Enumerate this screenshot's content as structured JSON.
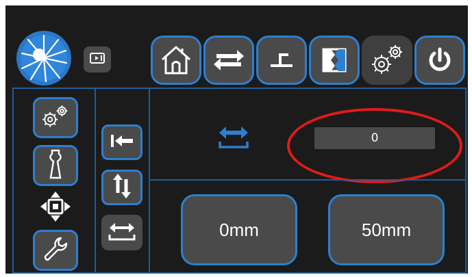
{
  "theme": {
    "background": "#1b1b1b",
    "button_fill": "#4a4a4a",
    "accent_border": "#2d7fd0",
    "panel_border": "#1f5d9a",
    "highlight": "#e11b1b",
    "text": "#ffffff"
  },
  "header": {
    "logo_icon": "sunburst-logo-icon",
    "camera_icon": "video-camera-icon",
    "nav": [
      {
        "icon": "home-icon"
      },
      {
        "icon": "swap-arrows-icon"
      },
      {
        "icon": "step-icon"
      },
      {
        "icon": "split-door-icon"
      },
      {
        "icon": "gears-icon",
        "active": true
      },
      {
        "icon": "power-icon"
      }
    ]
  },
  "sidebar": {
    "items": [
      {
        "icon": "gears-icon"
      },
      {
        "icon": "weight-icon"
      },
      {
        "icon": "move-arrows-icon"
      },
      {
        "icon": "wrench-icon"
      }
    ]
  },
  "tools": {
    "items": [
      {
        "icon": "arrow-to-left-bar-icon"
      },
      {
        "icon": "up-down-arrows-icon"
      },
      {
        "icon": "horizontal-width-icon"
      }
    ]
  },
  "main": {
    "axis_icon": "horizontal-width-icon",
    "value": "0",
    "presets": [
      {
        "label": "0mm"
      },
      {
        "label": "50mm"
      }
    ]
  }
}
